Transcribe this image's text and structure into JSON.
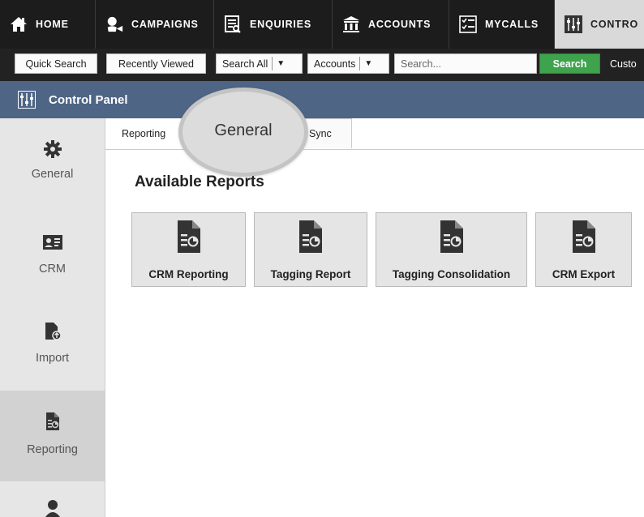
{
  "nav": {
    "items": [
      {
        "label": "HOME",
        "icon": "home-icon"
      },
      {
        "label": "CAMPAIGNS",
        "icon": "campaigns-icon"
      },
      {
        "label": "ENQUIRIES",
        "icon": "enquiries-icon"
      },
      {
        "label": "ACCOUNTS",
        "icon": "bank-icon"
      },
      {
        "label": "MYCALLS",
        "icon": "checklist-icon"
      },
      {
        "label": "CONTRO",
        "icon": "control-panel-icon",
        "active": true
      }
    ]
  },
  "searchbar": {
    "quick_search": "Quick Search",
    "recently_viewed": "Recently Viewed",
    "scope_select": "Search All",
    "type_select": "Accounts",
    "search_placeholder": "Search...",
    "search_button": "Search",
    "custom_link": "Custo"
  },
  "panel": {
    "title": "Control Panel",
    "icon": "control-panel-icon"
  },
  "sidebar": {
    "items": [
      {
        "label": "General",
        "icon": "gear-icon"
      },
      {
        "label": "CRM",
        "icon": "contact-card-icon"
      },
      {
        "label": "Import",
        "icon": "import-file-icon"
      },
      {
        "label": "Reporting",
        "icon": "report-icon",
        "active": true
      },
      {
        "label": "",
        "icon": "user-icon"
      }
    ]
  },
  "tabs": {
    "reporting": "Reporting",
    "sync": "Sync"
  },
  "magnifier": {
    "label": "General"
  },
  "main": {
    "heading": "Available Reports",
    "reports": [
      {
        "label": "CRM Reporting",
        "icon": "report-icon"
      },
      {
        "label": "Tagging Report",
        "icon": "report-icon"
      },
      {
        "label": "Tagging Consolidation",
        "icon": "report-icon"
      },
      {
        "label": "CRM Export",
        "icon": "report-icon"
      }
    ]
  },
  "colors": {
    "nav_bg": "#1c1c1c",
    "panel_header": "#4e6585",
    "search_button": "#3fa34d",
    "sidebar_bg": "#e6e6e6",
    "sidebar_active": "#d2d2d2"
  }
}
